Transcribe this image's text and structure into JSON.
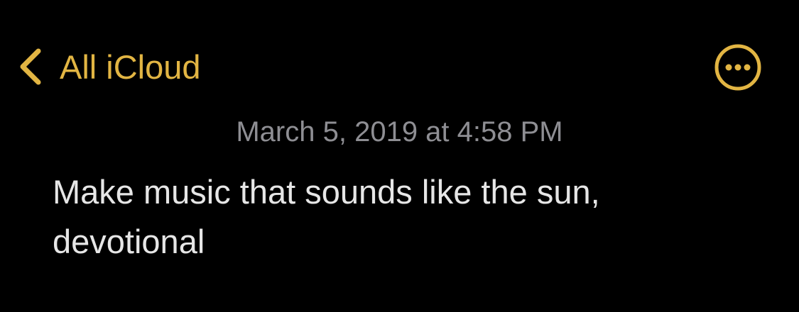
{
  "nav": {
    "back_label": "All iCloud",
    "back_icon": "chevron-left-icon",
    "more_icon": "ellipsis-circle-icon"
  },
  "note": {
    "date": "March 5, 2019 at 4:58 PM",
    "lines": [
      "Make music that sounds like the sun,",
      "devotional"
    ]
  },
  "colors": {
    "background": "#000000",
    "accent": "#E2B543",
    "date_text": "#8E8E93",
    "body_text": "#E6E6E6"
  }
}
